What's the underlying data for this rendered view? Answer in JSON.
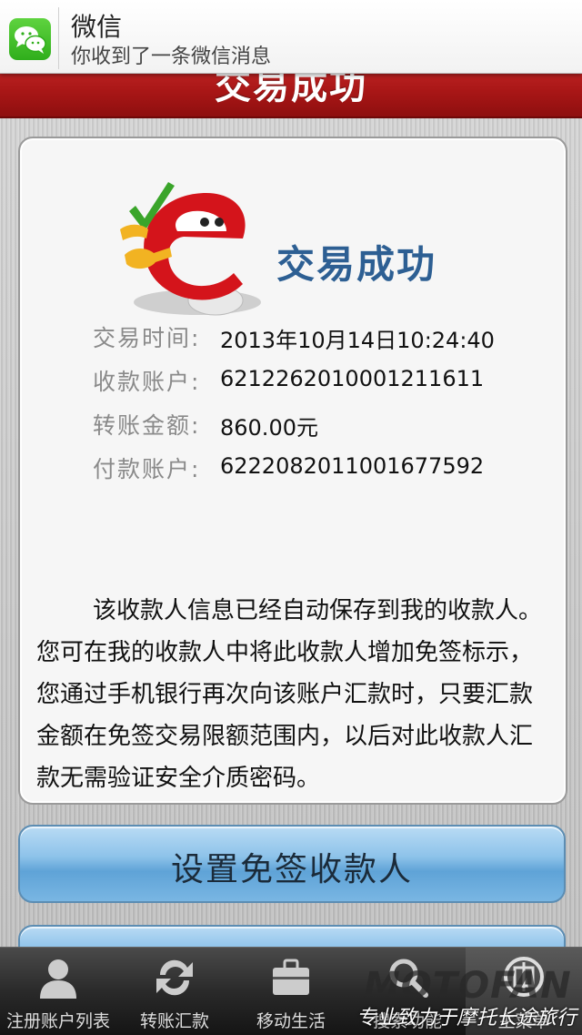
{
  "notification": {
    "app_name": "微信",
    "message": "你收到了一条微信消息"
  },
  "header": {
    "title": "交易成功"
  },
  "card": {
    "success_title": "交易成功",
    "details": [
      {
        "label": "交易时间:",
        "value": "2013年10月14日10:24:40"
      },
      {
        "label": "收款账户:",
        "value": "6212262010001211611"
      },
      {
        "label": "转账金额:",
        "value": "860.00元"
      },
      {
        "label": "付款账户:",
        "value": "6222082011001677592"
      }
    ],
    "info_text": "该收款人信息已经自动保存到我的收款人。您可在我的收款人中将此收款人增加免签标示，您通过手机银行再次向该账户汇款时，只要汇款金额在免签交易限额范围内，以后对此收款人汇款无需验证安全介质密码。"
  },
  "buttons": {
    "primary_label": "设置免签收款人"
  },
  "tabbar": {
    "tabs": [
      {
        "label": "注册账户列表",
        "icon": "person-icon"
      },
      {
        "label": "转账汇款",
        "icon": "refresh-icon"
      },
      {
        "label": "移动生活",
        "icon": "briefcase-icon"
      },
      {
        "label": "搜索功能",
        "icon": "search-icon"
      },
      {
        "label": "主菜单",
        "icon": "bank-logo-icon"
      }
    ]
  },
  "watermark": {
    "brand": "MOTOFAN",
    "slogan": "专业致力于摩托长途旅行"
  },
  "colors": {
    "header_red": "#b01d1d",
    "accent_blue": "#2d5f93",
    "button_blue": "#8ec3ea"
  }
}
